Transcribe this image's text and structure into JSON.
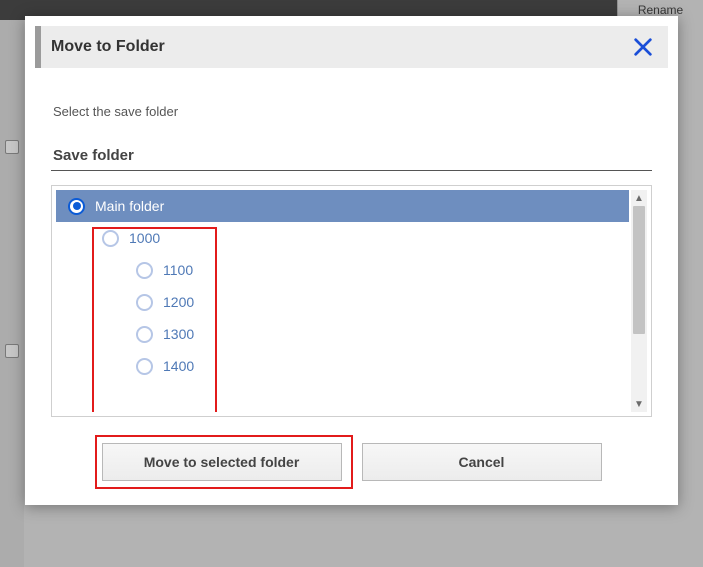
{
  "background": {
    "rename_label": "Rename"
  },
  "modal": {
    "title": "Move to Folder",
    "instruction": "Select the save folder",
    "section_label": "Save folder",
    "close_icon": "close-x"
  },
  "tree": {
    "selected_index": 0,
    "items": [
      {
        "label": "Main folder",
        "level": 0,
        "selected": true
      },
      {
        "label": "1000",
        "level": 1,
        "selected": false
      },
      {
        "label": "1100",
        "level": 2,
        "selected": false
      },
      {
        "label": "1200",
        "level": 2,
        "selected": false
      },
      {
        "label": "1300",
        "level": 2,
        "selected": false
      },
      {
        "label": "1400",
        "level": 2,
        "selected": false
      }
    ]
  },
  "buttons": {
    "confirm": "Move to selected folder",
    "cancel": "Cancel"
  }
}
